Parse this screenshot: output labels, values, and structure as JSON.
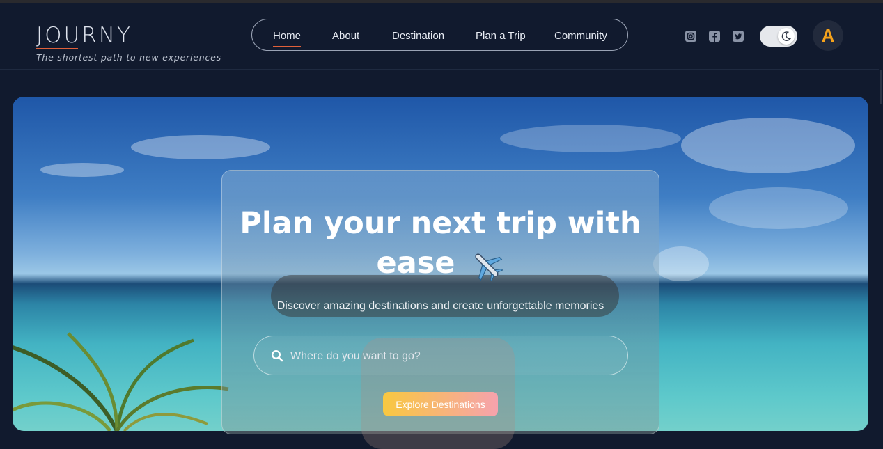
{
  "brand": {
    "name": "JOURNY",
    "tagline": "The shortest path to new experiences"
  },
  "nav": {
    "items": [
      {
        "label": "Home",
        "active": true
      },
      {
        "label": "About"
      },
      {
        "label": "Destination"
      },
      {
        "label": "Plan a Trip"
      },
      {
        "label": "Community"
      }
    ]
  },
  "social": [
    "instagram-icon",
    "facebook-icon",
    "twitter-icon"
  ],
  "theme_toggle": {
    "state": "dark",
    "icon": "moon-icon"
  },
  "user": {
    "initial": "A"
  },
  "hero": {
    "title_line1": "Plan your next trip with",
    "title_line2": "ease",
    "title_emoji": "airplane-icon",
    "subtitle": "Discover amazing destinations and create unforgettable memories",
    "search_placeholder": "Where do you want to go?",
    "cta_label": "Explore Destinations"
  },
  "colors": {
    "background": "#111a2e",
    "accent": "#e0603a",
    "avatar_letter": "#f5a21b",
    "cta_start": "#f8c840",
    "cta_end": "#f6a2ad"
  }
}
